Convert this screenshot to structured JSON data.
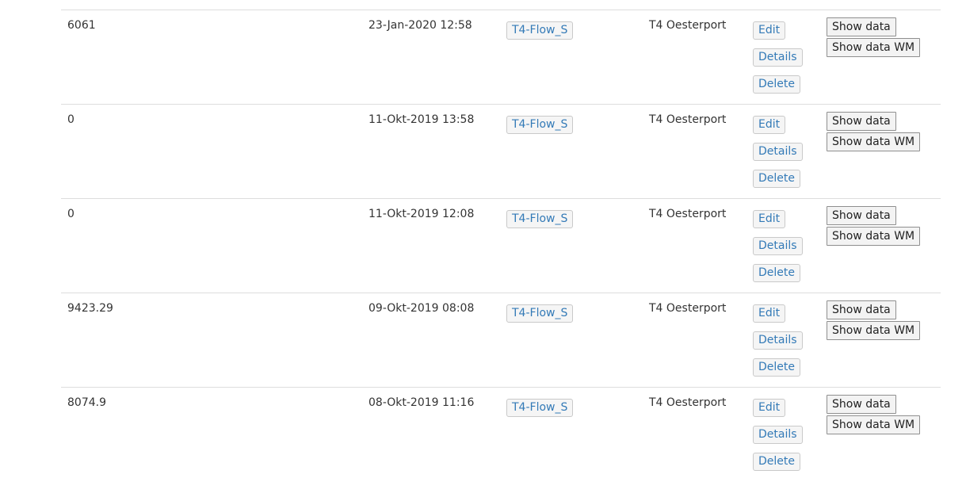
{
  "rows": [
    {
      "value": "6061",
      "date": "23-Jan-2020 12:58",
      "tag": "T4-Flow_S",
      "location": "T4 Oesterport"
    },
    {
      "value": "0",
      "date": "11-Okt-2019 13:58",
      "tag": "T4-Flow_S",
      "location": "T4 Oesterport"
    },
    {
      "value": "0",
      "date": "11-Okt-2019 12:08",
      "tag": "T4-Flow_S",
      "location": "T4 Oesterport"
    },
    {
      "value": "9423.29",
      "date": "09-Okt-2019 08:08",
      "tag": "T4-Flow_S",
      "location": "T4 Oesterport"
    },
    {
      "value": "8074.9",
      "date": "08-Okt-2019 11:16",
      "tag": "T4-Flow_S",
      "location": "T4 Oesterport"
    }
  ],
  "actions": {
    "edit": "Edit",
    "details": "Details",
    "delete": "Delete",
    "show_data": "Show data",
    "show_data_wm": "Show data WM"
  },
  "colors": {
    "link": "#337ab7",
    "border": "#dddddd",
    "text": "#333333"
  }
}
